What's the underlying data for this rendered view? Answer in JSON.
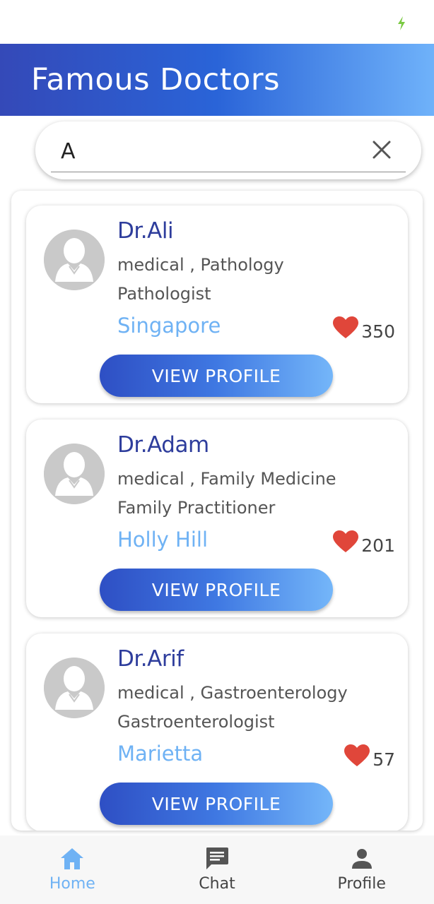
{
  "app": {
    "title": "Famous Doctors"
  },
  "search": {
    "value": "A",
    "placeholder": ""
  },
  "doctors": [
    {
      "name": "Dr.Ali",
      "specialty": "medical , Pathology",
      "title": "Pathologist",
      "city": "Singapore",
      "likes": "350",
      "button_label": "VIEW PROFILE"
    },
    {
      "name": "Dr.Adam",
      "specialty": "medical , Family Medicine",
      "title": "Family Practitioner",
      "city": "Holly Hill",
      "likes": "201",
      "button_label": "VIEW PROFILE"
    },
    {
      "name": "Dr.Arif",
      "specialty": "medical , Gastroenterology",
      "title": "Gastroenterologist",
      "city": "Marietta",
      "likes": "57",
      "button_label": "VIEW PROFILE"
    }
  ],
  "nav": {
    "items": [
      {
        "label": "Home",
        "icon": "home-icon",
        "active": true
      },
      {
        "label": "Chat",
        "icon": "chat-icon",
        "active": false
      },
      {
        "label": "Profile",
        "icon": "person-icon",
        "active": false
      }
    ]
  },
  "colors": {
    "header_gradient_start": "#3449b8",
    "header_gradient_end": "#6fb2fa",
    "name_color": "#2e3d9c",
    "city_color": "#6fb2f4",
    "heart_color": "#e0463a",
    "active_nav": "#6fb2f4"
  }
}
